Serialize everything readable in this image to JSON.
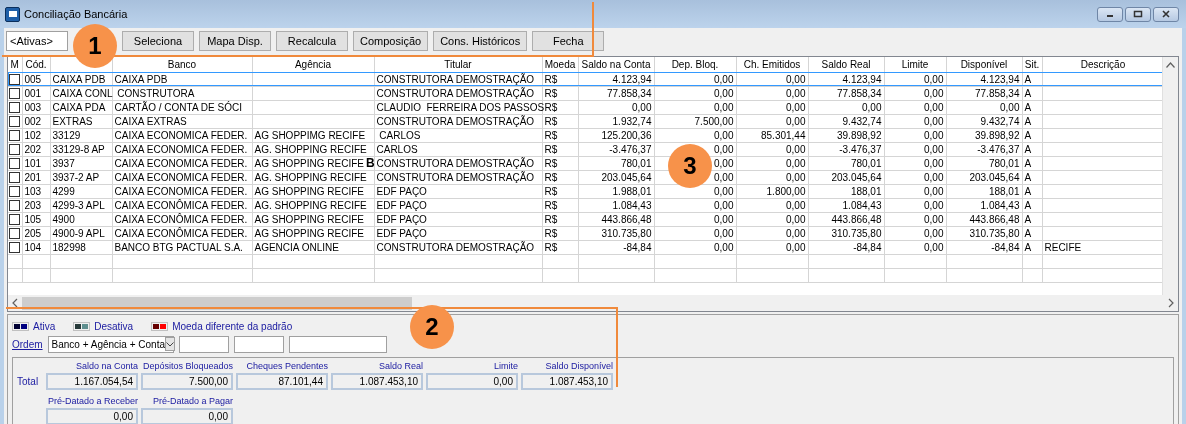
{
  "window": {
    "title": "Conciliação Bancária"
  },
  "toolbar": {
    "filter": {
      "value": "<Ativas>"
    },
    "buttons": [
      "Seleciona",
      "Mapa Disp.",
      "Recalcula",
      "Composição",
      "Cons. Históricos",
      "Fecha"
    ]
  },
  "table": {
    "columns": {
      "m": "M",
      "cod": "Cód.",
      "banco": "Banco",
      "agencia": "Agência",
      "titular": "Titular",
      "moeda": "Moeda",
      "saldo_conta": "Saldo na Conta",
      "dep_bloq": "Dep. Bloq.",
      "ch_emitidos": "Ch. Emitidos",
      "saldo_real": "Saldo Real",
      "limite": "Limite",
      "disponivel": "Disponível",
      "sit": "Sit.",
      "descricao": "Descrição"
    },
    "rows": [
      {
        "selected": true,
        "checked": false,
        "cod": "005",
        "conta": "CAIXA PDB",
        "banco": "CAIXA PDB",
        "titular": "CONSTRUTORA DEMOSTRAÇÃO",
        "moeda": "R$",
        "saldo_conta": "4.123,94",
        "dep_bloq": "0,00",
        "ch_emitidos": "0,00",
        "saldo_real": "4.123,94",
        "limite": "0,00",
        "disponivel": "4.123,94",
        "sit": "A"
      },
      {
        "selected": false,
        "checked": false,
        "cod": "001",
        "conta": "CAIXA CONL",
        "banco": " CONSTRUTORA",
        "titular": "CONSTRUTORA DEMOSTRAÇÃO",
        "moeda": "R$",
        "saldo_conta": "77.858,34",
        "dep_bloq": "0,00",
        "ch_emitidos": "0,00",
        "saldo_real": "77.858,34",
        "limite": "0,00",
        "disponivel": "77.858,34",
        "sit": "A"
      },
      {
        "selected": false,
        "checked": false,
        "cod": "003",
        "conta": "CAIXA PDA",
        "banco": "CARTÃO / CONTA DE SÓCI",
        "titular": "CLAUDIO  FERREIRA DOS PASSOS",
        "moeda": "R$",
        "saldo_conta": "0,00",
        "dep_bloq": "0,00",
        "ch_emitidos": "0,00",
        "saldo_real": "0,00",
        "limite": "0,00",
        "disponivel": "0,00",
        "sit": "A"
      },
      {
        "selected": false,
        "checked": false,
        "cod": "002",
        "conta": "EXTRAS",
        "banco": "CAIXA EXTRAS",
        "titular": "CONSTRUTORA DEMOSTRAÇÃO",
        "moeda": "R$",
        "saldo_conta": "1.932,74",
        "dep_bloq": "7.500,00",
        "ch_emitidos": "0,00",
        "saldo_real": "9.432,74",
        "limite": "0,00",
        "disponivel": "9.432,74",
        "sit": "A"
      },
      {
        "selected": false,
        "checked": false,
        "cod": "102",
        "conta": "33129",
        "banco": "CAIXA ECONOMICA FEDER.",
        "agencia": "AG SHOPPIMG RECIFE",
        "titular": " CARLOS",
        "moeda": "R$",
        "saldo_conta": "125.200,36",
        "dep_bloq": "0,00",
        "ch_emitidos": "85.301,44",
        "saldo_real": "39.898,92",
        "limite": "0,00",
        "disponivel": "39.898,92",
        "sit": "A"
      },
      {
        "selected": false,
        "checked": false,
        "cod": "202",
        "conta": "33129-8 AP",
        "banco": "CAIXA ECONOMICA FEDER.",
        "agencia": "AG. SHOPPING RECIFE",
        "titular": "CARLOS",
        "moeda": "R$",
        "saldo_conta": "-3.476,37",
        "dep_bloq": "0,00",
        "ch_emitidos": "0,00",
        "saldo_real": "-3.476,37",
        "limite": "0,00",
        "disponivel": "-3.476,37",
        "sit": "A"
      },
      {
        "selected": false,
        "checked": false,
        "cod": "101",
        "conta": "3937",
        "banco": "CAIXA ECONOMICA FEDER.",
        "agencia": "AG SHOPPING RECIFE",
        "titular": "CONSTRUTORA DEMOSTRAÇÃO",
        "moeda": "R$",
        "saldo_conta": "780,01",
        "dep_bloq": "0,00",
        "ch_emitidos": "0,00",
        "saldo_real": "780,01",
        "limite": "0,00",
        "disponivel": "780,01",
        "sit": "A"
      },
      {
        "selected": false,
        "checked": false,
        "cod": "201",
        "conta": "3937-2 AP",
        "banco": "CAIXA ECONOMICA FEDER.",
        "agencia": "AG. SHOPPING RECIFE",
        "titular": "CONSTRUTORA DEMOSTRAÇÃO",
        "moeda": "R$",
        "saldo_conta": "203.045,64",
        "dep_bloq": "0,00",
        "ch_emitidos": "0,00",
        "saldo_real": "203.045,64",
        "limite": "0,00",
        "disponivel": "203.045,64",
        "sit": "A"
      },
      {
        "selected": false,
        "checked": false,
        "cod": "103",
        "conta": "4299",
        "banco": "CAIXA ECONOMICA FEDER.",
        "agencia": "AG SHOPPING RECIFE",
        "titular": "EDF PAÇO",
        "moeda": "R$",
        "saldo_conta": "1.988,01",
        "dep_bloq": "0,00",
        "ch_emitidos": "1.800,00",
        "saldo_real": "188,01",
        "limite": "0,00",
        "disponivel": "188,01",
        "sit": "A"
      },
      {
        "selected": false,
        "checked": false,
        "cod": "203",
        "conta": "4299-3 APL",
        "banco": "CAIXA ECONÔMICA FEDER.",
        "agencia": "AG. SHOPPING RECIFE",
        "titular": "EDF PAÇO",
        "moeda": "R$",
        "saldo_conta": "1.084,43",
        "dep_bloq": "0,00",
        "ch_emitidos": "0,00",
        "saldo_real": "1.084,43",
        "limite": "0,00",
        "disponivel": "1.084,43",
        "sit": "A"
      },
      {
        "selected": false,
        "checked": false,
        "cod": "105",
        "conta": "4900",
        "banco": "CAIXA ECONÔMICA FEDER.",
        "agencia": "AG SHOPPING RECIFE",
        "titular": "EDF PAÇO",
        "moeda": "R$",
        "saldo_conta": "443.866,48",
        "dep_bloq": "0,00",
        "ch_emitidos": "0,00",
        "saldo_real": "443.866,48",
        "limite": "0,00",
        "disponivel": "443.866,48",
        "sit": "A"
      },
      {
        "selected": false,
        "checked": false,
        "cod": "205",
        "conta": "4900-9 APL",
        "banco": "CAIXA ECONÔMICA FEDER.",
        "agencia": "AG SHOPPING RECIFE",
        "titular": "EDF PAÇO",
        "moeda": "R$",
        "saldo_conta": "310.735,80",
        "dep_bloq": "0,00",
        "ch_emitidos": "0,00",
        "saldo_real": "310.735,80",
        "limite": "0,00",
        "disponivel": "310.735,80",
        "sit": "A"
      },
      {
        "selected": false,
        "checked": false,
        "cod": "104",
        "conta": "182998",
        "banco": "BANCO BTG PACTUAL S.A.",
        "agencia": "AGENCIA ONLINE",
        "titular": "CONSTRUTORA DEMOSTRAÇÃO",
        "moeda": "R$",
        "saldo_conta": "-84,84",
        "dep_bloq": "0,00",
        "ch_emitidos": "0,00",
        "saldo_real": "-84,84",
        "limite": "0,00",
        "disponivel": "-84,84",
        "sit": "A",
        "descricao": "RECIFE"
      }
    ]
  },
  "legend": [
    {
      "label": "Ativa",
      "color": "#000080"
    },
    {
      "label": "Desativa",
      "color": "#5f8f8f"
    },
    {
      "label": "Moeda diferente da padrão",
      "color": "#ff0000"
    }
  ],
  "order": {
    "label": "Ordem",
    "value": "Banco + Agência + Conta"
  },
  "totals": {
    "row_label": "Total",
    "fields": [
      {
        "label": "Saldo na Conta",
        "value": "1.167.054,54"
      },
      {
        "label": "Depósitos Bloqueados",
        "value": "7.500,00"
      },
      {
        "label": "Cheques Pendentes",
        "value": "87.101,44"
      },
      {
        "label": "Saldo Real",
        "value": "1.087.453,10"
      },
      {
        "label": "Limite",
        "value": "0,00"
      },
      {
        "label": "Saldo Disponível",
        "value": "1.087.453,10"
      }
    ],
    "postdated": [
      {
        "label": "Pré-Datado a Receber",
        "value": "0,00"
      },
      {
        "label": "Pré-Datado a Pagar",
        "value": "0,00"
      }
    ]
  },
  "annotations": [
    {
      "kind": "callout",
      "label": "1"
    },
    {
      "kind": "callout",
      "label": "2"
    },
    {
      "kind": "callout",
      "label": "3"
    },
    {
      "kind": "letter",
      "label": "B"
    }
  ]
}
